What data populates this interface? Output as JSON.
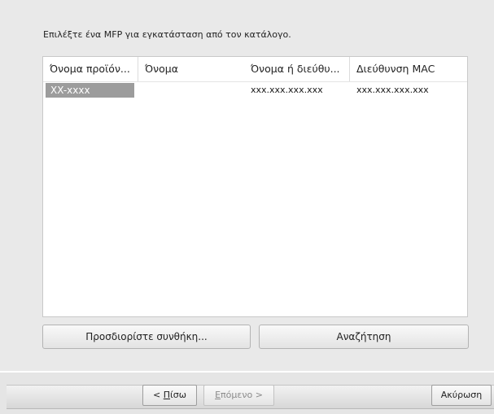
{
  "instruction": "Επιλέξτε ένα MFP για εγκατάσταση από τον κατάλογο.",
  "table": {
    "columns": [
      "Όνομα προϊόν...",
      "Όνομα",
      "Όνομα ή διεύθυ...",
      "Διεύθυνση MAC"
    ],
    "rows": [
      {
        "product": "XX-xxxx",
        "name": "",
        "address": "xxx.xxx.xxx.xxx",
        "mac": "xxx.xxx.xxx.xxx"
      }
    ]
  },
  "buttons": {
    "specify_condition": "Προσδιορίστε συνθήκη...",
    "search": "Αναζήτηση"
  },
  "footer": {
    "back_prefix": "< ",
    "back_key": "Π",
    "back_rest": "ίσω",
    "next_key": "Ε",
    "next_rest": "πόμενο >",
    "cancel": "Ακύρωση"
  },
  "colors": {
    "selection": "#9c9c9c",
    "panel": "#e9e9e9"
  }
}
